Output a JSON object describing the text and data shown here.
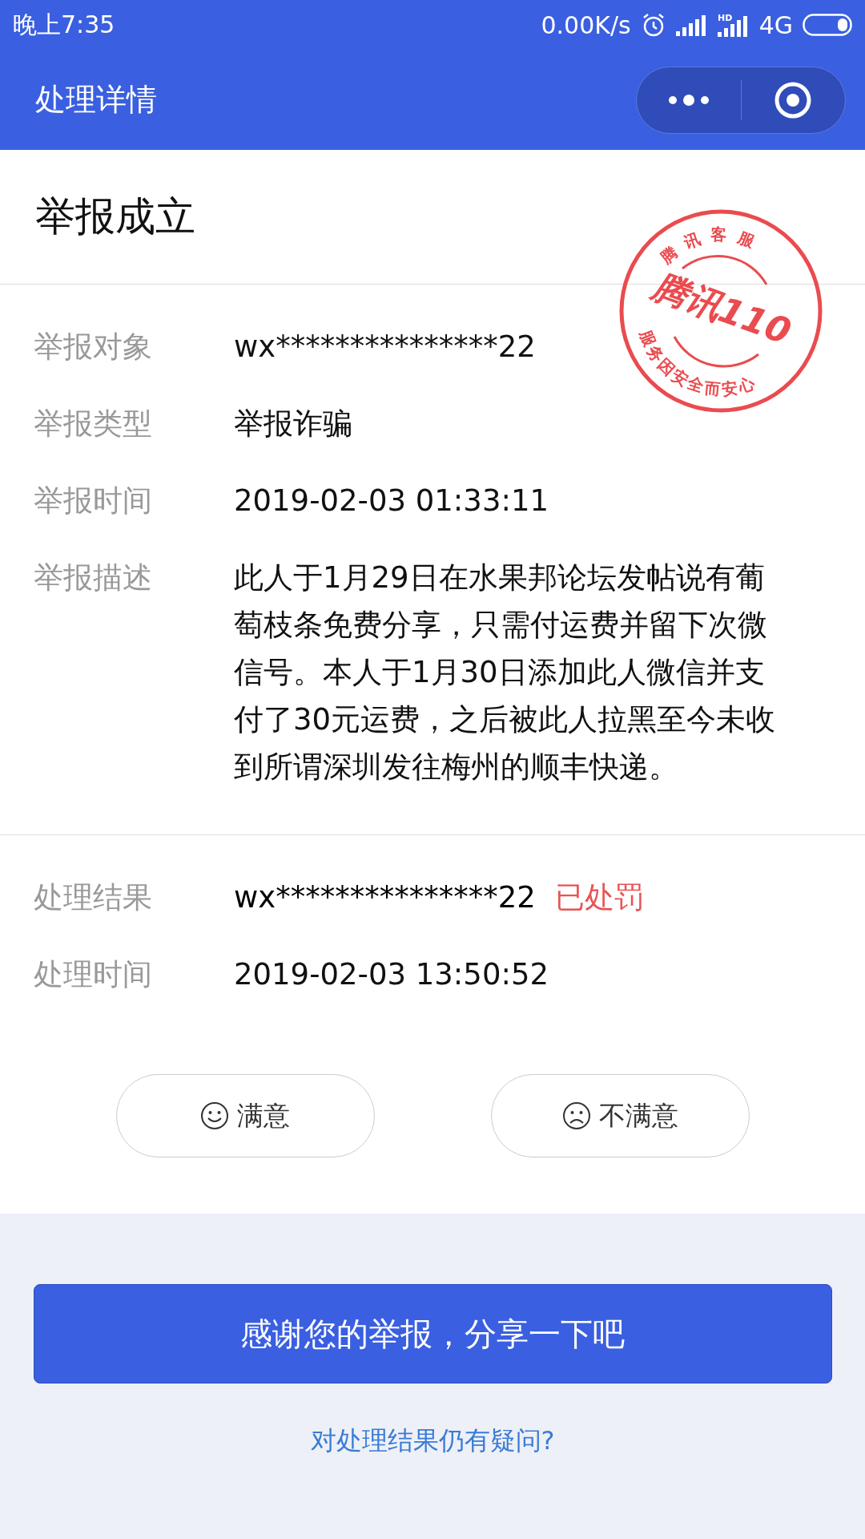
{
  "status_bar": {
    "time": "晚上7:35",
    "speed": "0.00K/s",
    "hd": "HD",
    "network": "4G"
  },
  "nav": {
    "title": "处理详情"
  },
  "report": {
    "heading": "举报成立",
    "stamp": {
      "top": "腾讯客服",
      "center": "腾讯110",
      "bottom": "服务因安全而安心"
    },
    "fields": [
      {
        "label": "举报对象",
        "value": "wx***************22"
      },
      {
        "label": "举报类型",
        "value": "举报诈骗"
      },
      {
        "label": "举报时间",
        "value": "2019-02-03 01:33:11"
      },
      {
        "label": "举报描述",
        "value": "此人于1月29日在水果邦论坛发帖说有葡萄枝条免费分享，只需付运费并留下次微信号。本人于1月30日添加此人微信并支付了30元运费，之后被此人拉黑至今未收到所谓深圳发往梅州的顺丰快递。"
      }
    ]
  },
  "result": {
    "fields": [
      {
        "label": "处理结果",
        "value": "wx***************22",
        "tag": "已处罚"
      },
      {
        "label": "处理时间",
        "value": "2019-02-03 13:50:52"
      }
    ],
    "feedback": [
      {
        "kind": "happy",
        "label": "满意"
      },
      {
        "kind": "sad",
        "label": "不满意"
      }
    ]
  },
  "share_button": "感谢您的举报，分享一下吧",
  "question_link": "对处理结果仍有疑问?"
}
